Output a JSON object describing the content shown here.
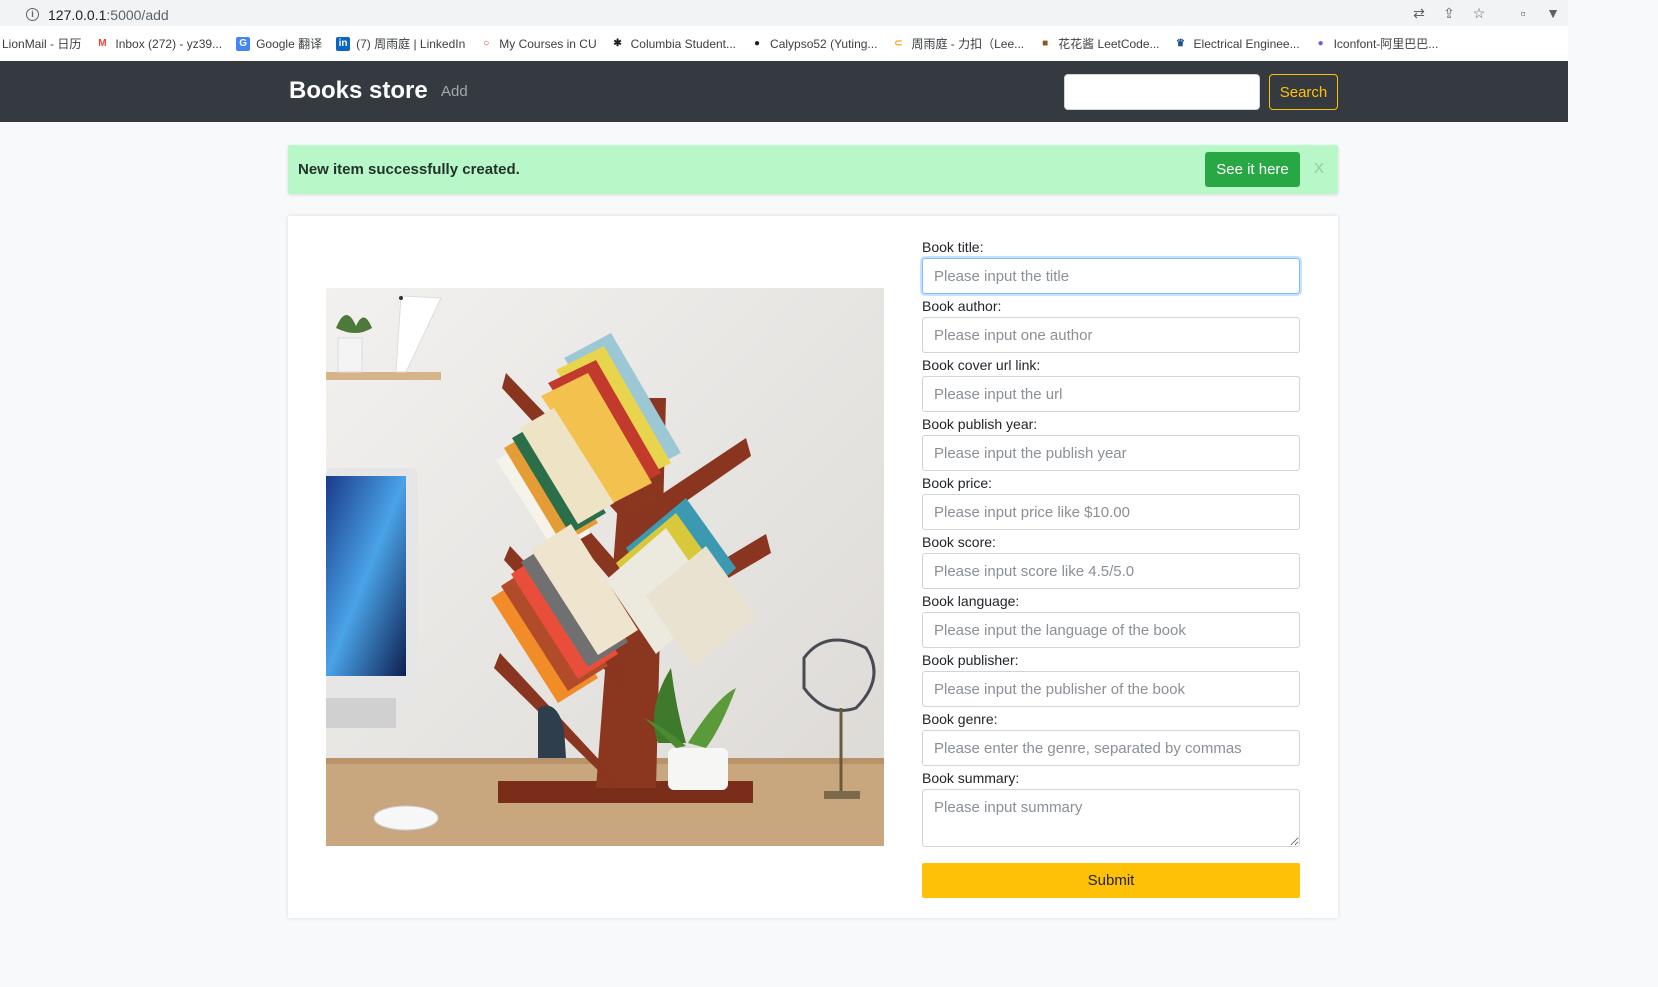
{
  "browser": {
    "url_host": "127.0.0.1",
    "url_path": ":5000/add",
    "bookmarks": [
      {
        "label": "LionMail - 日历",
        "icon": "",
        "icon_color": "#ffffff",
        "icon_bg": "transparent"
      },
      {
        "label": "Inbox (272) - yz39...",
        "icon": "M",
        "icon_color": "#ea4335",
        "icon_bg": "transparent"
      },
      {
        "label": "Google 翻译",
        "icon": "G",
        "icon_color": "#ffffff",
        "icon_bg": "#4285f4"
      },
      {
        "label": "(7) 周雨庭 | LinkedIn",
        "icon": "in",
        "icon_color": "#ffffff",
        "icon_bg": "#0a66c2"
      },
      {
        "label": "My Courses in CU",
        "icon": "○",
        "icon_color": "#d93025",
        "icon_bg": "transparent"
      },
      {
        "label": "Columbia Student...",
        "icon": "✱",
        "icon_color": "#202124",
        "icon_bg": "transparent"
      },
      {
        "label": "Calypso52 (Yuting...",
        "icon": "●",
        "icon_color": "#202124",
        "icon_bg": "transparent"
      },
      {
        "label": "周雨庭 - 力扣（Lee...",
        "icon": "⊂",
        "icon_color": "#f89f1b",
        "icon_bg": "transparent"
      },
      {
        "label": "花花酱 LeetCode...",
        "icon": "■",
        "icon_color": "#8d5524",
        "icon_bg": "transparent"
      },
      {
        "label": "Electrical Enginee...",
        "icon": "♛",
        "icon_color": "#1d4f91",
        "icon_bg": "transparent"
      },
      {
        "label": "Iconfont-阿里巴巴...",
        "icon": "●",
        "icon_color": "#6c5ce7",
        "icon_bg": "transparent"
      }
    ]
  },
  "navbar": {
    "brand": "Books store",
    "add_link": "Add",
    "search_button": "Search",
    "search_value": ""
  },
  "alert": {
    "message": "New item successfully created.",
    "button": "See it here",
    "close": "X"
  },
  "form": {
    "fields": [
      {
        "label": "Book title:",
        "placeholder": "Please input the title"
      },
      {
        "label": "Book author:",
        "placeholder": "Please input one author"
      },
      {
        "label": "Book cover url link:",
        "placeholder": "Please input the url"
      },
      {
        "label": "Book publish year:",
        "placeholder": "Please input the publish year"
      },
      {
        "label": "Book price:",
        "placeholder": "Please input price like $10.00"
      },
      {
        "label": "Book score:",
        "placeholder": "Please input score like 4.5/5.0"
      },
      {
        "label": "Book language:",
        "placeholder": "Please input the language of the book"
      },
      {
        "label": "Book publisher:",
        "placeholder": "Please input the publisher of the book"
      },
      {
        "label": "Book genre:",
        "placeholder": "Please enter the genre, separated by commas"
      }
    ],
    "summary": {
      "label": "Book summary:",
      "placeholder": "Please input summary"
    },
    "submit": "Submit"
  },
  "colors": {
    "navbar_bg": "#343a40",
    "accent": "#ffc107",
    "success": "#28a745",
    "alert_bg": "#b7f7c8"
  }
}
